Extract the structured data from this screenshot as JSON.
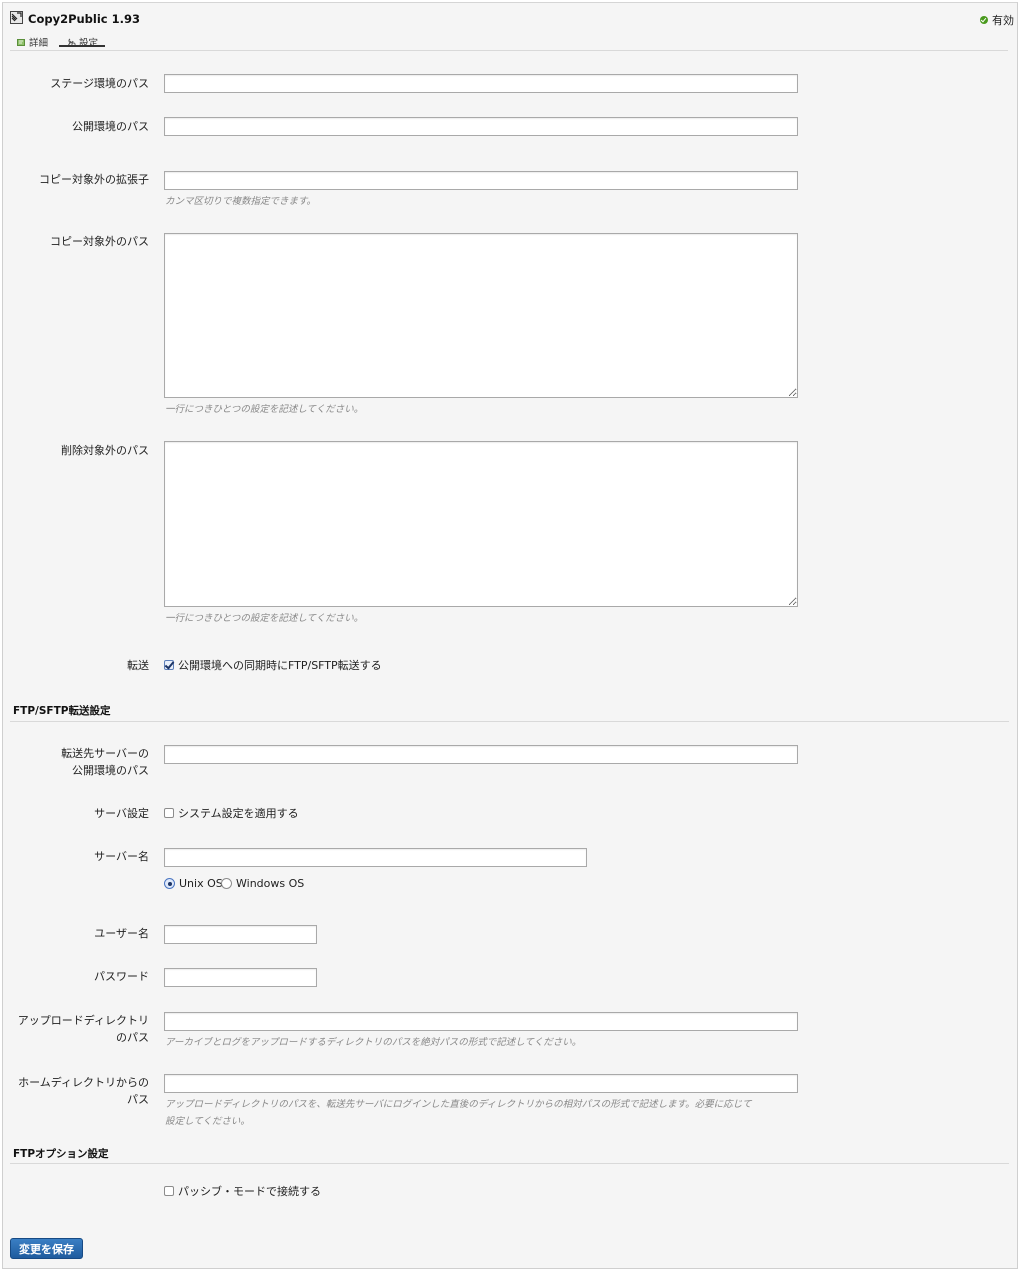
{
  "plugin": {
    "title": "Copy2Public 1.93",
    "icon": "plugin-icon",
    "status": "有効",
    "status_color": "#4a9a1e"
  },
  "tabs": [
    {
      "label": "詳細",
      "icon": "info-icon",
      "active": false
    },
    {
      "label": "設定",
      "icon": "settings-icon",
      "active": true
    }
  ],
  "fields": {
    "stage_path": {
      "label": "ステージ環境のパス",
      "value": ""
    },
    "public_path": {
      "label": "公開環境のパス",
      "value": ""
    },
    "exclude_ext": {
      "label": "コピー対象外の拡張子",
      "value": "",
      "hint": "カンマ区切りで複数指定できます。"
    },
    "exclude_copy_path": {
      "label": "コピー対象外のパス",
      "value": "",
      "hint": "一行につきひとつの設定を記述してください。"
    },
    "exclude_delete_path": {
      "label": "削除対象外のパス",
      "value": "",
      "hint": "一行につきひとつの設定を記述してください。"
    },
    "transfer": {
      "label": "転送",
      "checkbox_label": "公開環境への同期時にFTP/SFTP転送する",
      "checked": true
    }
  },
  "ftp_section": {
    "title": "FTP/SFTP転送設定",
    "remote_public_path": {
      "label_line1": "転送先サーバーの",
      "label_line2": "公開環境のパス",
      "value": ""
    },
    "server_setting": {
      "label": "サーバ設定",
      "checkbox_label": "システム設定を適用する",
      "checked": false
    },
    "server_name": {
      "label": "サーバー名",
      "value": ""
    },
    "os_options": [
      {
        "label": "Unix OS",
        "checked": true
      },
      {
        "label": "Windows OS",
        "checked": false
      }
    ],
    "username": {
      "label": "ユーザー名",
      "value": ""
    },
    "password": {
      "label": "パスワード",
      "value": ""
    },
    "upload_dir": {
      "label_line1": "アップロードディレクトリ",
      "label_line2": "のパス",
      "value": "",
      "hint": "アーカイブとログをアップロードするディレクトリのパスを絶対パスの形式で記述してください。"
    },
    "home_dir": {
      "label_line1": "ホームディレクトリからの",
      "label_line2": "パス",
      "value": "",
      "hint_line1": "アップロードディレクトリのパスを、転送先サーバにログインした直後のディレクトリからの相対パスの形式で記述します。必要に応じて",
      "hint_line2": "設定してください。"
    }
  },
  "ftp_option_section": {
    "title": "FTPオプション設定",
    "passive": {
      "checkbox_label": "パッシブ・モードで接続する",
      "checked": false
    }
  },
  "save_button": {
    "label": "変更を保存",
    "color": "#2a6db3"
  }
}
